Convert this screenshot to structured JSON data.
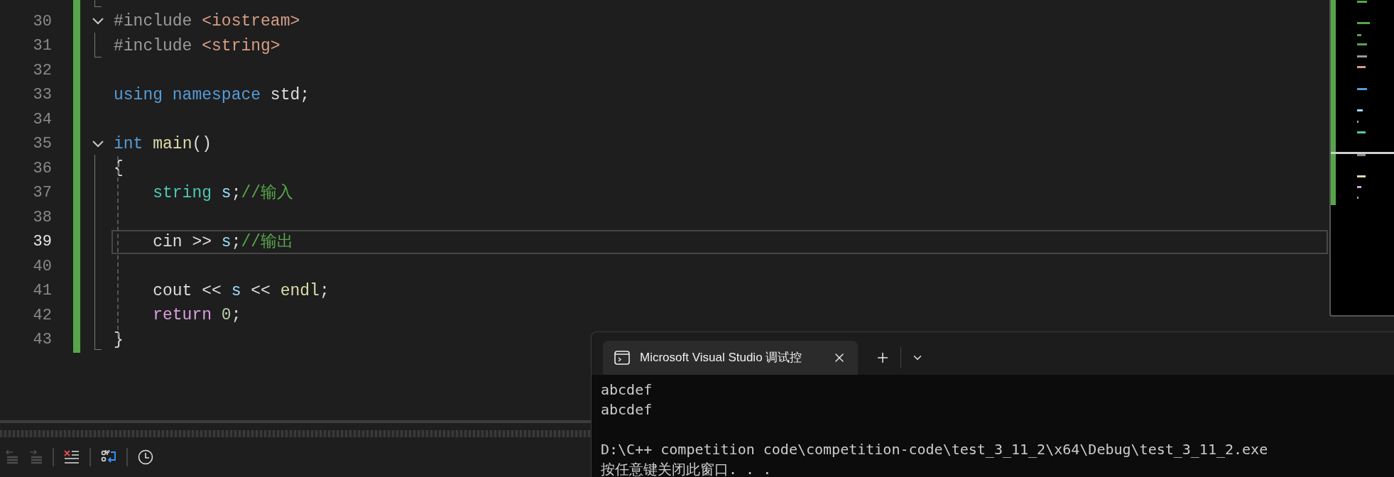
{
  "editor": {
    "lines": [
      {
        "number": "30",
        "foldable": true,
        "current": false,
        "tokens": [
          {
            "kind": "preprocessor",
            "text": "#include "
          },
          {
            "kind": "string",
            "text": "<iostream>"
          }
        ]
      },
      {
        "number": "31",
        "current": false,
        "tokens": [
          {
            "kind": "preprocessor",
            "text": "#include "
          },
          {
            "kind": "string",
            "text": "<string>"
          }
        ]
      },
      {
        "number": "32",
        "current": false
      },
      {
        "number": "33",
        "current": false,
        "tokens": [
          {
            "kind": "keyword",
            "text": "using namespace"
          },
          {
            "kind": "plain",
            "text": " std;"
          }
        ]
      },
      {
        "number": "34",
        "current": false
      },
      {
        "number": "35",
        "foldable": true,
        "current": false,
        "tokens": [
          {
            "kind": "keyword",
            "text": "int"
          },
          {
            "kind": "function",
            "text": " main"
          },
          {
            "kind": "plain",
            "text": "()"
          }
        ]
      },
      {
        "number": "36",
        "current": false,
        "tokens": [
          {
            "kind": "plain",
            "text": "{"
          }
        ]
      },
      {
        "number": "37",
        "current": false,
        "tokens": [
          {
            "kind": "type",
            "text": "    string"
          },
          {
            "kind": "variable",
            "text": " s"
          },
          {
            "kind": "plain",
            "text": ";"
          },
          {
            "kind": "comment",
            "text": "//输入"
          }
        ]
      },
      {
        "number": "38",
        "current": false
      },
      {
        "number": "39",
        "current": true,
        "tokens": [
          {
            "kind": "plain",
            "text": "    cin >> "
          },
          {
            "kind": "variable",
            "text": "s"
          },
          {
            "kind": "plain",
            "text": ";"
          },
          {
            "kind": "comment",
            "text": "//输出"
          }
        ]
      },
      {
        "number": "40",
        "current": false
      },
      {
        "number": "41",
        "current": false,
        "tokens": [
          {
            "kind": "plain",
            "text": "    cout << "
          },
          {
            "kind": "variable",
            "text": "s"
          },
          {
            "kind": "plain",
            "text": " << "
          },
          {
            "kind": "function",
            "text": "endl"
          },
          {
            "kind": "plain",
            "text": ";"
          }
        ]
      },
      {
        "number": "42",
        "current": false,
        "tokens": [
          {
            "kind": "control",
            "text": "    return"
          },
          {
            "kind": "number",
            "text": " 0"
          },
          {
            "kind": "plain",
            "text": ";"
          }
        ]
      },
      {
        "number": "43",
        "current": false,
        "tokens": [
          {
            "kind": "plain",
            "text": "}"
          }
        ]
      }
    ]
  },
  "toolbar": [
    {
      "kind": "outdent",
      "disabled": true
    },
    {
      "kind": "indent",
      "disabled": true
    },
    {
      "kind": "clear",
      "disabled": false
    },
    {
      "kind": "wrap",
      "disabled": false
    },
    {
      "kind": "history",
      "disabled": false
    }
  ],
  "terminal": {
    "tab": {
      "title": "Microsoft Visual Studio 调试控",
      "selected": true
    },
    "output": [
      [
        "abcdef",
        "abcdef"
      ],
      [
        "D:\\C++ competition code\\competition-code\\test_3_11_2\\x64\\Debug\\test_3_11_2.exe",
        "按任意键关闭此窗口. . ."
      ]
    ]
  }
}
